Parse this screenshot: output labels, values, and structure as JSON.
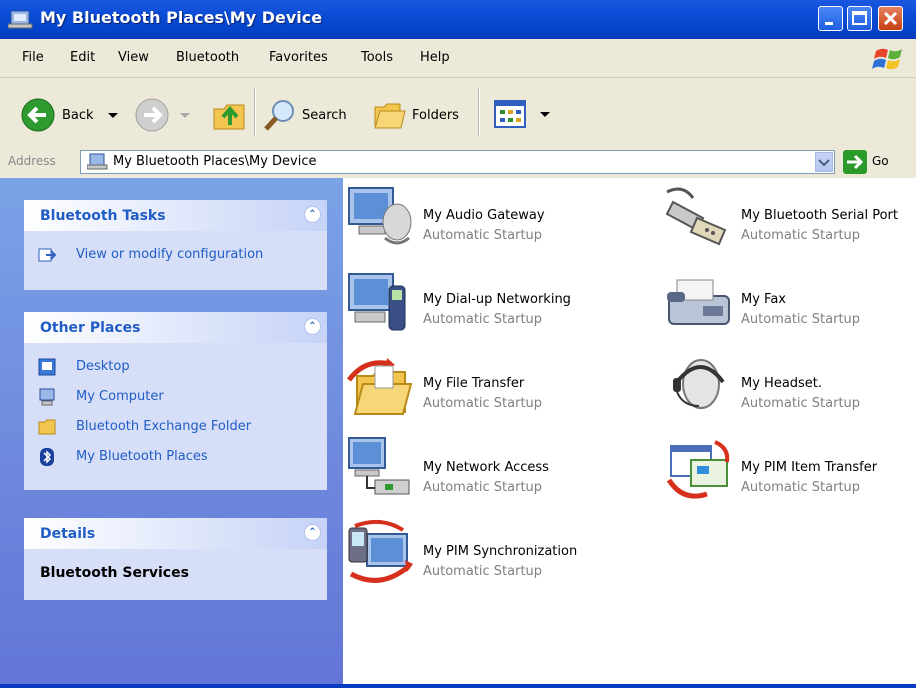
{
  "window": {
    "title": "My Bluetooth Places\\My Device"
  },
  "menu": {
    "items": [
      "File",
      "Edit",
      "View",
      "Bluetooth",
      "Favorites",
      "Tools",
      "Help"
    ]
  },
  "toolbar": {
    "back_label": "Back",
    "search_label": "Search",
    "folders_label": "Folders"
  },
  "address": {
    "label": "Address",
    "value": "My Bluetooth Places\\My Device",
    "go_label": "Go"
  },
  "left": {
    "bluetooth_tasks": {
      "title": "Bluetooth Tasks",
      "items": [
        {
          "label": "View or modify configuration"
        }
      ]
    },
    "other_places": {
      "title": "Other Places",
      "items": [
        {
          "label": "Desktop"
        },
        {
          "label": "My Computer"
        },
        {
          "label": "Bluetooth Exchange Folder"
        },
        {
          "label": "My Bluetooth Places"
        }
      ]
    },
    "details": {
      "title": "Details",
      "value": "Bluetooth Services"
    }
  },
  "services": [
    {
      "name": "My Audio Gateway",
      "status": "Automatic Startup"
    },
    {
      "name": "My Bluetooth Serial Port",
      "status": "Automatic Startup"
    },
    {
      "name": "My Dial-up Networking",
      "status": "Automatic Startup"
    },
    {
      "name": "My Fax",
      "status": "Automatic Startup"
    },
    {
      "name": "My File Transfer",
      "status": "Automatic Startup"
    },
    {
      "name": "My Headset.",
      "status": "Automatic Startup"
    },
    {
      "name": "My Network Access",
      "status": "Automatic Startup"
    },
    {
      "name": "My PIM Item Transfer",
      "status": "Automatic Startup"
    },
    {
      "name": "My PIM Synchronization",
      "status": "Automatic Startup"
    }
  ],
  "colors": {
    "titlebar": "#0a4cd6",
    "task_link": "#215dc6",
    "pane": "#6e8be0",
    "status_text": "#808080"
  }
}
